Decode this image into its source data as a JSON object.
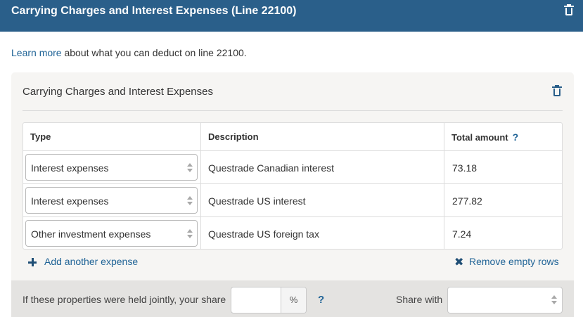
{
  "header": {
    "title": "Carrying Charges and Interest Expenses (Line 22100)",
    "delete_icon": "trash-icon"
  },
  "intro": {
    "link_text": "Learn more",
    "rest_text": " about what you can deduct on line 22100."
  },
  "panel": {
    "title": "Carrying Charges and Interest Expenses",
    "delete_icon": "trash-icon",
    "columns": {
      "type": "Type",
      "description": "Description",
      "total": "Total amount",
      "total_help": "?"
    },
    "rows": [
      {
        "type": "Interest expenses",
        "description": "Questrade Canadian interest",
        "amount": "73.18"
      },
      {
        "type": "Interest expenses",
        "description": "Questrade US interest",
        "amount": "277.82"
      },
      {
        "type": "Other investment expenses",
        "description": "Questrade US foreign tax",
        "amount": "7.24"
      }
    ],
    "add_label": "Add another expense",
    "remove_label": "Remove empty rows"
  },
  "footer": {
    "joint_label": "If these properties were held jointly, your share",
    "percent_value": "",
    "percent_suffix": "%",
    "help": "?",
    "share_with_label": "Share with",
    "share_with_value": ""
  },
  "colors": {
    "header_bg": "#2a5f8a",
    "link": "#1f6396",
    "panel_bg": "#f6f5f3",
    "footer_bg": "#e4e3e1"
  }
}
